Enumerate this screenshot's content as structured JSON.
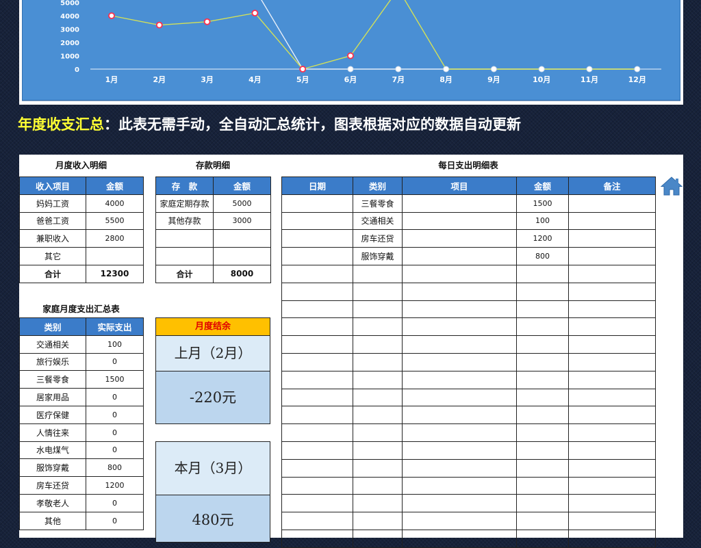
{
  "chart_data": {
    "type": "line",
    "categories": [
      "1月",
      "2月",
      "3月",
      "4月",
      "5月",
      "6月",
      "7月",
      "8月",
      "9月",
      "10月",
      "11月",
      "12月"
    ],
    "y_ticks": [
      "0",
      "1000",
      "2000",
      "3000",
      "4000",
      "5000"
    ],
    "ylim": [
      0,
      5800
    ],
    "series": [
      {
        "values": [
          4000,
          3300,
          3550,
          4200,
          0,
          1000,
          6000,
          0,
          0,
          0,
          0,
          0
        ],
        "color": "#d4e157",
        "marker": "#ff2e4c"
      },
      {
        "values": [
          null,
          null,
          null,
          6000,
          0,
          0,
          0,
          0,
          0,
          0,
          0,
          0
        ],
        "color": "#e6eef8",
        "marker": "#ffffff"
      }
    ],
    "background": "#4a8fd4",
    "grid": false
  },
  "banner": {
    "highlight": "年度收支汇总",
    "text": "：此表无需手动，全自动汇总统计，图表根据对应的数据自动更新"
  },
  "income": {
    "title": "月度收入明细",
    "headers": [
      "收入项目",
      "金额"
    ],
    "rows": [
      [
        "妈妈工资",
        "4000"
      ],
      [
        "爸爸工资",
        "5500"
      ],
      [
        "兼职收入",
        "2800"
      ],
      [
        "其它",
        ""
      ]
    ],
    "total_label": "合计",
    "total_value": "12300"
  },
  "savings": {
    "title": "存款明细",
    "headers": [
      "存　款",
      "金额"
    ],
    "rows": [
      [
        "家庭定期存款",
        "5000"
      ],
      [
        "其他存款",
        "3000"
      ],
      [
        "",
        ""
      ],
      [
        "",
        ""
      ]
    ],
    "total_label": "合计",
    "total_value": "8000"
  },
  "daily": {
    "title": "每日支出明细表",
    "headers": [
      "日期",
      "类别",
      "项目",
      "金额",
      "备注"
    ],
    "rows": [
      [
        "",
        "三餐零食",
        "",
        "1500",
        ""
      ],
      [
        "",
        "交通相关",
        "",
        "100",
        ""
      ],
      [
        "",
        "房车还贷",
        "",
        "1200",
        ""
      ],
      [
        "",
        "服饰穿戴",
        "",
        "800",
        ""
      ],
      [
        "",
        "",
        "",
        "",
        ""
      ],
      [
        "",
        "",
        "",
        "",
        ""
      ],
      [
        "",
        "",
        "",
        "",
        ""
      ],
      [
        "",
        "",
        "",
        "",
        ""
      ],
      [
        "",
        "",
        "",
        "",
        ""
      ],
      [
        "",
        "",
        "",
        "",
        ""
      ],
      [
        "",
        "",
        "",
        "",
        ""
      ],
      [
        "",
        "",
        "",
        "",
        ""
      ],
      [
        "",
        "",
        "",
        "",
        ""
      ],
      [
        "",
        "",
        "",
        "",
        ""
      ],
      [
        "",
        "",
        "",
        "",
        ""
      ],
      [
        "",
        "",
        "",
        "",
        ""
      ],
      [
        "",
        "",
        "",
        "",
        ""
      ],
      [
        "",
        "",
        "",
        "",
        ""
      ],
      [
        "",
        "",
        "",
        "",
        ""
      ],
      [
        "",
        "",
        "",
        "",
        ""
      ]
    ]
  },
  "summary": {
    "title": "家庭月度支出汇总表",
    "headers": [
      "类别",
      "实际支出"
    ],
    "rows": [
      [
        "交通相关",
        "100"
      ],
      [
        "旅行娱乐",
        "0"
      ],
      [
        "三餐零食",
        "1500"
      ],
      [
        "居家用品",
        "0"
      ],
      [
        "医疗保健",
        "0"
      ],
      [
        "人情往来",
        "0"
      ],
      [
        "水电煤气",
        "0"
      ],
      [
        "服饰穿戴",
        "800"
      ],
      [
        "房车还贷",
        "1200"
      ],
      [
        "孝敬老人",
        "0"
      ],
      [
        "其他",
        "0"
      ]
    ]
  },
  "balance": {
    "header": "月度结余",
    "last_month_label": "上月（2月）",
    "last_month_value": "-220元",
    "this_month_label": "本月（3月）",
    "this_month_value": "480元"
  },
  "icons": {
    "home": "home-icon"
  },
  "colors": {
    "header_blue": "#3b7cc9",
    "banner_yellow": "#ffff33",
    "balance_head": "#ffc000"
  }
}
